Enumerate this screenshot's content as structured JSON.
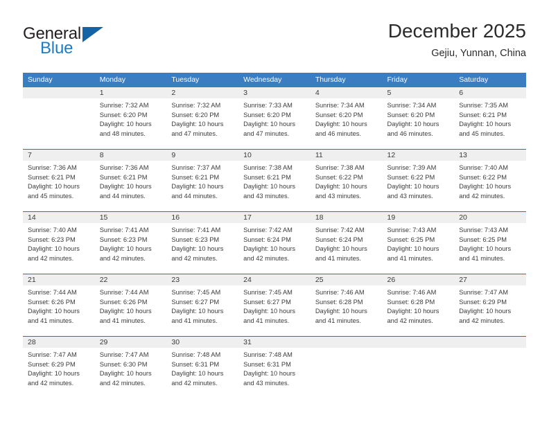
{
  "brand": {
    "name_part1": "General",
    "name_part2": "Blue",
    "accent_color": "#1464a5",
    "blue_text_color": "#1e7bc4",
    "logo_icon": "triangle-flag-icon"
  },
  "header": {
    "title": "December 2025",
    "subtitle": "Gejiu, Yunnan, China"
  },
  "calendar": {
    "header_bg": "#3b7dc0",
    "day_band_bg": "#efefef",
    "row_separator_color": "#2f6cb3",
    "weekdays": [
      "Sunday",
      "Monday",
      "Tuesday",
      "Wednesday",
      "Thursday",
      "Friday",
      "Saturday"
    ],
    "labels": {
      "sunrise": "Sunrise:",
      "sunset": "Sunset:",
      "daylight": "Daylight:"
    },
    "weeks": [
      [
        {
          "day": "",
          "empty": true
        },
        {
          "day": "1",
          "sunrise": "Sunrise: 7:32 AM",
          "sunset": "Sunset: 6:20 PM",
          "daylight_line1": "Daylight: 10 hours",
          "daylight_line2": "and 48 minutes."
        },
        {
          "day": "2",
          "sunrise": "Sunrise: 7:32 AM",
          "sunset": "Sunset: 6:20 PM",
          "daylight_line1": "Daylight: 10 hours",
          "daylight_line2": "and 47 minutes."
        },
        {
          "day": "3",
          "sunrise": "Sunrise: 7:33 AM",
          "sunset": "Sunset: 6:20 PM",
          "daylight_line1": "Daylight: 10 hours",
          "daylight_line2": "and 47 minutes."
        },
        {
          "day": "4",
          "sunrise": "Sunrise: 7:34 AM",
          "sunset": "Sunset: 6:20 PM",
          "daylight_line1": "Daylight: 10 hours",
          "daylight_line2": "and 46 minutes."
        },
        {
          "day": "5",
          "sunrise": "Sunrise: 7:34 AM",
          "sunset": "Sunset: 6:20 PM",
          "daylight_line1": "Daylight: 10 hours",
          "daylight_line2": "and 46 minutes."
        },
        {
          "day": "6",
          "sunrise": "Sunrise: 7:35 AM",
          "sunset": "Sunset: 6:21 PM",
          "daylight_line1": "Daylight: 10 hours",
          "daylight_line2": "and 45 minutes."
        }
      ],
      [
        {
          "day": "7",
          "sunrise": "Sunrise: 7:36 AM",
          "sunset": "Sunset: 6:21 PM",
          "daylight_line1": "Daylight: 10 hours",
          "daylight_line2": "and 45 minutes."
        },
        {
          "day": "8",
          "sunrise": "Sunrise: 7:36 AM",
          "sunset": "Sunset: 6:21 PM",
          "daylight_line1": "Daylight: 10 hours",
          "daylight_line2": "and 44 minutes."
        },
        {
          "day": "9",
          "sunrise": "Sunrise: 7:37 AM",
          "sunset": "Sunset: 6:21 PM",
          "daylight_line1": "Daylight: 10 hours",
          "daylight_line2": "and 44 minutes."
        },
        {
          "day": "10",
          "sunrise": "Sunrise: 7:38 AM",
          "sunset": "Sunset: 6:21 PM",
          "daylight_line1": "Daylight: 10 hours",
          "daylight_line2": "and 43 minutes."
        },
        {
          "day": "11",
          "sunrise": "Sunrise: 7:38 AM",
          "sunset": "Sunset: 6:22 PM",
          "daylight_line1": "Daylight: 10 hours",
          "daylight_line2": "and 43 minutes."
        },
        {
          "day": "12",
          "sunrise": "Sunrise: 7:39 AM",
          "sunset": "Sunset: 6:22 PM",
          "daylight_line1": "Daylight: 10 hours",
          "daylight_line2": "and 43 minutes."
        },
        {
          "day": "13",
          "sunrise": "Sunrise: 7:40 AM",
          "sunset": "Sunset: 6:22 PM",
          "daylight_line1": "Daylight: 10 hours",
          "daylight_line2": "and 42 minutes."
        }
      ],
      [
        {
          "day": "14",
          "sunrise": "Sunrise: 7:40 AM",
          "sunset": "Sunset: 6:23 PM",
          "daylight_line1": "Daylight: 10 hours",
          "daylight_line2": "and 42 minutes."
        },
        {
          "day": "15",
          "sunrise": "Sunrise: 7:41 AM",
          "sunset": "Sunset: 6:23 PM",
          "daylight_line1": "Daylight: 10 hours",
          "daylight_line2": "and 42 minutes."
        },
        {
          "day": "16",
          "sunrise": "Sunrise: 7:41 AM",
          "sunset": "Sunset: 6:23 PM",
          "daylight_line1": "Daylight: 10 hours",
          "daylight_line2": "and 42 minutes."
        },
        {
          "day": "17",
          "sunrise": "Sunrise: 7:42 AM",
          "sunset": "Sunset: 6:24 PM",
          "daylight_line1": "Daylight: 10 hours",
          "daylight_line2": "and 42 minutes."
        },
        {
          "day": "18",
          "sunrise": "Sunrise: 7:42 AM",
          "sunset": "Sunset: 6:24 PM",
          "daylight_line1": "Daylight: 10 hours",
          "daylight_line2": "and 41 minutes."
        },
        {
          "day": "19",
          "sunrise": "Sunrise: 7:43 AM",
          "sunset": "Sunset: 6:25 PM",
          "daylight_line1": "Daylight: 10 hours",
          "daylight_line2": "and 41 minutes."
        },
        {
          "day": "20",
          "sunrise": "Sunrise: 7:43 AM",
          "sunset": "Sunset: 6:25 PM",
          "daylight_line1": "Daylight: 10 hours",
          "daylight_line2": "and 41 minutes."
        }
      ],
      [
        {
          "day": "21",
          "sunrise": "Sunrise: 7:44 AM",
          "sunset": "Sunset: 6:26 PM",
          "daylight_line1": "Daylight: 10 hours",
          "daylight_line2": "and 41 minutes."
        },
        {
          "day": "22",
          "sunrise": "Sunrise: 7:44 AM",
          "sunset": "Sunset: 6:26 PM",
          "daylight_line1": "Daylight: 10 hours",
          "daylight_line2": "and 41 minutes."
        },
        {
          "day": "23",
          "sunrise": "Sunrise: 7:45 AM",
          "sunset": "Sunset: 6:27 PM",
          "daylight_line1": "Daylight: 10 hours",
          "daylight_line2": "and 41 minutes."
        },
        {
          "day": "24",
          "sunrise": "Sunrise: 7:45 AM",
          "sunset": "Sunset: 6:27 PM",
          "daylight_line1": "Daylight: 10 hours",
          "daylight_line2": "and 41 minutes."
        },
        {
          "day": "25",
          "sunrise": "Sunrise: 7:46 AM",
          "sunset": "Sunset: 6:28 PM",
          "daylight_line1": "Daylight: 10 hours",
          "daylight_line2": "and 41 minutes."
        },
        {
          "day": "26",
          "sunrise": "Sunrise: 7:46 AM",
          "sunset": "Sunset: 6:28 PM",
          "daylight_line1": "Daylight: 10 hours",
          "daylight_line2": "and 42 minutes."
        },
        {
          "day": "27",
          "sunrise": "Sunrise: 7:47 AM",
          "sunset": "Sunset: 6:29 PM",
          "daylight_line1": "Daylight: 10 hours",
          "daylight_line2": "and 42 minutes."
        }
      ],
      [
        {
          "day": "28",
          "sunrise": "Sunrise: 7:47 AM",
          "sunset": "Sunset: 6:29 PM",
          "daylight_line1": "Daylight: 10 hours",
          "daylight_line2": "and 42 minutes."
        },
        {
          "day": "29",
          "sunrise": "Sunrise: 7:47 AM",
          "sunset": "Sunset: 6:30 PM",
          "daylight_line1": "Daylight: 10 hours",
          "daylight_line2": "and 42 minutes."
        },
        {
          "day": "30",
          "sunrise": "Sunrise: 7:48 AM",
          "sunset": "Sunset: 6:31 PM",
          "daylight_line1": "Daylight: 10 hours",
          "daylight_line2": "and 42 minutes."
        },
        {
          "day": "31",
          "sunrise": "Sunrise: 7:48 AM",
          "sunset": "Sunset: 6:31 PM",
          "daylight_line1": "Daylight: 10 hours",
          "daylight_line2": "and 43 minutes."
        },
        {
          "day": "",
          "empty": true,
          "trailing": true
        },
        {
          "day": "",
          "empty": true,
          "trailing": true
        },
        {
          "day": "",
          "empty": true,
          "trailing": true
        }
      ]
    ]
  }
}
